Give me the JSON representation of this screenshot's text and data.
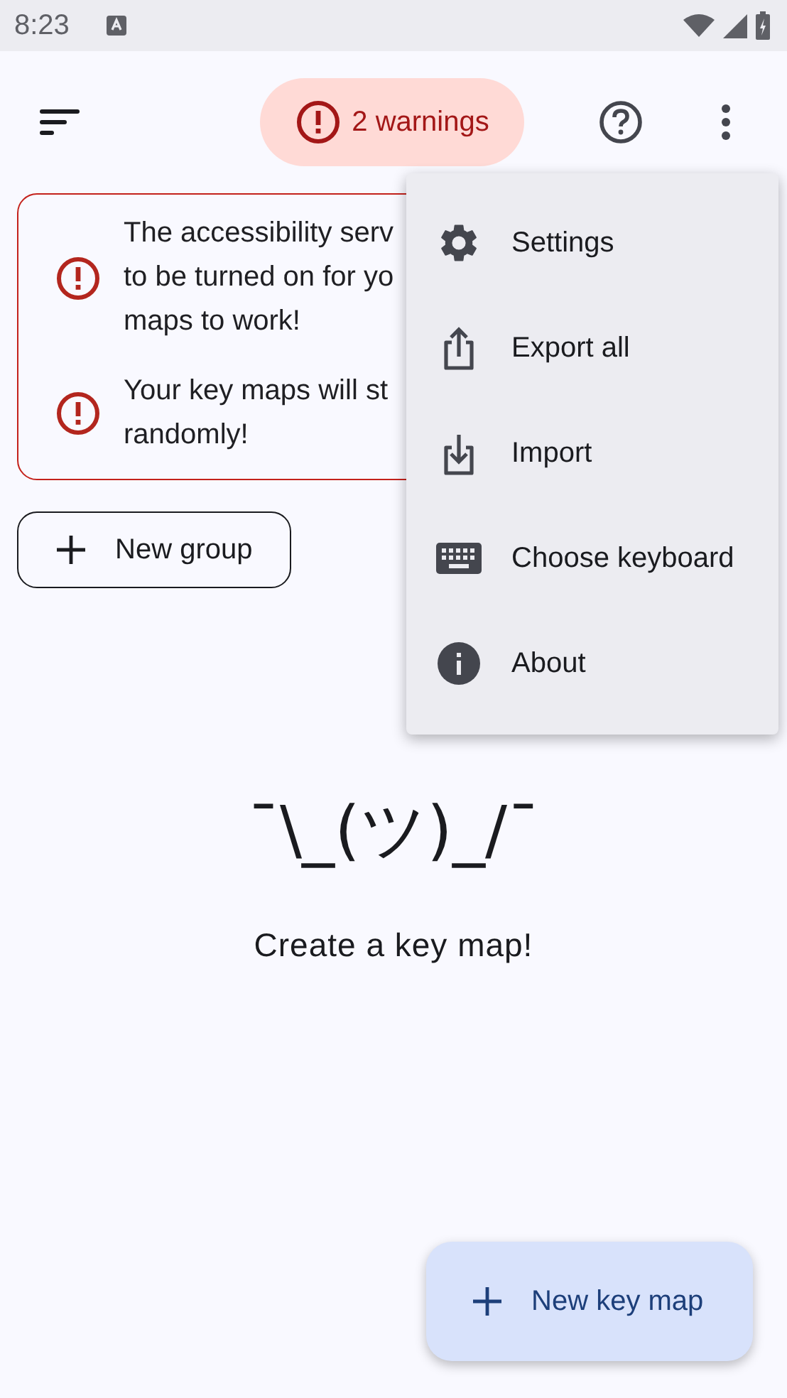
{
  "status_bar": {
    "time": "8:23"
  },
  "app_bar": {
    "warnings_label": "2 warnings"
  },
  "warnings": [
    {
      "lines": [
        "The accessibility serv",
        "to be turned on for yo",
        "maps to work!"
      ]
    },
    {
      "lines": [
        "Your key maps will st",
        "randomly!"
      ]
    }
  ],
  "new_group_button": {
    "label": "New group"
  },
  "empty_state": {
    "emoticon": "¯\\_(ツ)_/¯",
    "message": "Create a key map!"
  },
  "fab": {
    "label": "New key map"
  },
  "menu": {
    "items": [
      {
        "kind": "settings",
        "label": "Settings"
      },
      {
        "kind": "export",
        "label": "Export all"
      },
      {
        "kind": "import",
        "label": "Import"
      },
      {
        "kind": "keyboard",
        "label": "Choose keyboard"
      },
      {
        "kind": "about",
        "label": "About"
      }
    ]
  }
}
